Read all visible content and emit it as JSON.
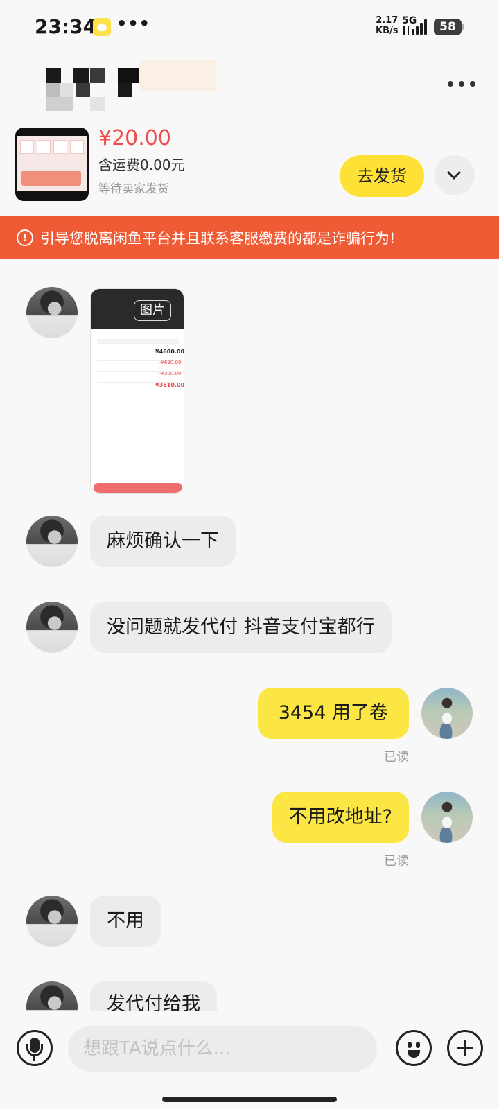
{
  "status_bar": {
    "time": "23:34",
    "dots": "•••",
    "net_speed_value": "2.17",
    "net_speed_unit": "KB/s",
    "network": "5G",
    "battery": "58"
  },
  "header": {
    "contact_name_blurred": true
  },
  "product": {
    "price": "¥20.00",
    "shipping": "含运费0.00元",
    "status": "等待卖家发货",
    "ship_button": "去发货"
  },
  "warning": {
    "icon_glyph": "!",
    "text": "引导您脱离闲鱼平台并且联系客服缴费的都是诈骗行为!"
  },
  "messages": [
    {
      "from": "them",
      "type": "image",
      "tag": "图片",
      "image_content": {
        "amount1": "¥4600.00",
        "amount2": "-¥690.00",
        "amount3": "-¥300.00",
        "amount4": "¥3610.00"
      }
    },
    {
      "from": "them",
      "type": "text",
      "text": "麻烦确认一下"
    },
    {
      "from": "them",
      "type": "text",
      "text": "没问题就发代付 抖音支付宝都行"
    },
    {
      "from": "me",
      "type": "text",
      "text": "3454 用了卷",
      "read": "已读"
    },
    {
      "from": "me",
      "type": "text",
      "text": "不用改地址?",
      "read": "已读"
    },
    {
      "from": "them",
      "type": "text",
      "text": "不用"
    },
    {
      "from": "them",
      "type": "text",
      "text": "发代付给我"
    }
  ],
  "input": {
    "placeholder": "想跟TA说点什么..."
  },
  "colors": {
    "accent_yellow": "#ffe135",
    "warning_orange": "#ee5b34",
    "price_red": "#ef4b4b"
  },
  "icons": [
    "mic-icon",
    "emoji-icon",
    "plus-icon",
    "more-icon",
    "chevron-down-icon",
    "warning-icon"
  ]
}
